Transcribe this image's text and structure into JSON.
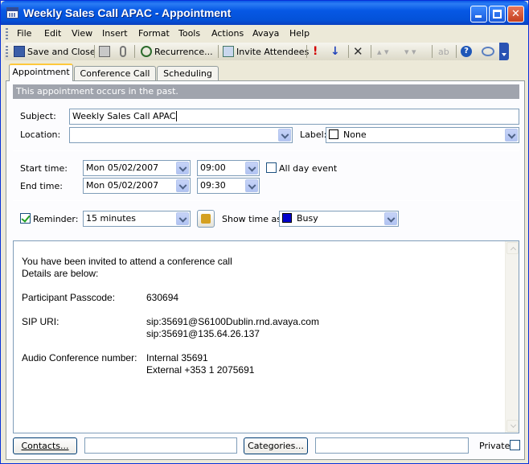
{
  "window": {
    "title": "Weekly Sales Call APAC - Appointment"
  },
  "menu": [
    "File",
    "Edit",
    "View",
    "Insert",
    "Format",
    "Tools",
    "Actions",
    "Avaya",
    "Help"
  ],
  "toolbar": {
    "save_close": "Save and Close",
    "recurrence": "Recurrence...",
    "invite": "Invite Attendees"
  },
  "tabs": [
    "Appointment",
    "Conference Call",
    "Scheduling"
  ],
  "info_bar": "This appointment occurs in the past.",
  "form": {
    "subject_label": "Subject:",
    "subject": "Weekly Sales Call APAC",
    "location_label": "Location:",
    "location": "",
    "label_label": "Label:",
    "label_value": "None",
    "label_color": "#ffffff",
    "start_label": "Start time:",
    "start_date": "Mon 05/02/2007",
    "start_time": "09:00",
    "all_day_label": "All day event",
    "all_day": false,
    "end_label": "End time:",
    "end_date": "Mon 05/02/2007",
    "end_time": "09:30",
    "reminder_label": "Reminder:",
    "reminder": "15 minutes",
    "reminder_checked": true,
    "show_as_label": "Show time as:",
    "show_as": "Busy",
    "show_as_color": "#0000cc"
  },
  "body": {
    "intro1": "You have been invited to attend a conference call",
    "intro2": "Details are below:",
    "passcode_label": "Participant Passcode:",
    "passcode": "630694",
    "sip_label": "SIP URI:",
    "sip1": "sip:35691@S6100Dublin.rnd.avaya.com",
    "sip2": "sip:35691@135.64.26.137",
    "audio_label": "Audio Conference number:",
    "audio1": "Internal 35691",
    "audio2": "External +353 1 2075691"
  },
  "footer": {
    "contacts": "Contacts...",
    "contacts_value": "",
    "categories": "Categories...",
    "categories_value": "",
    "private_label": "Private",
    "private": false
  }
}
